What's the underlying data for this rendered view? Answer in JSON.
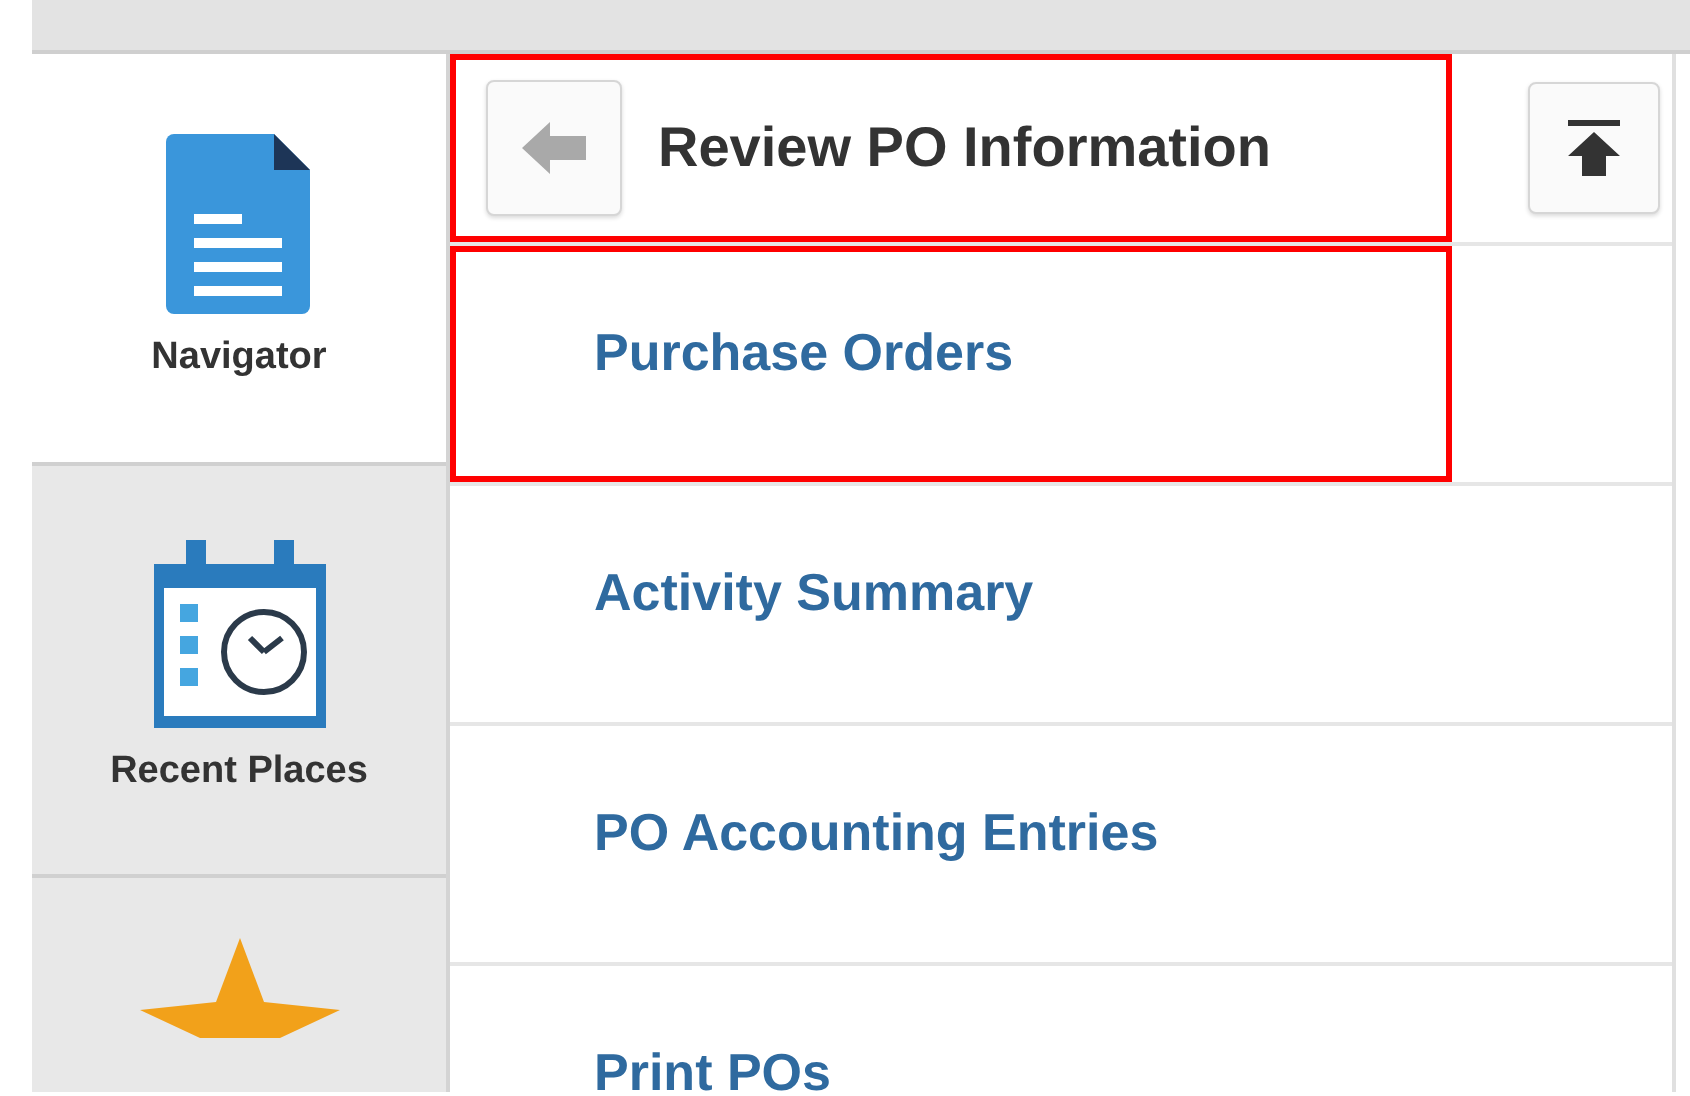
{
  "sidebar": {
    "tiles": [
      {
        "kind": "document",
        "label": "Navigator",
        "selected": true
      },
      {
        "kind": "calendar",
        "label": "Recent Places",
        "selected": false
      },
      {
        "kind": "star",
        "selected": false
      }
    ]
  },
  "header": {
    "title": "Review PO Information",
    "highlighted": true
  },
  "items": [
    {
      "label": "Purchase Orders",
      "highlighted": true
    },
    {
      "label": "Activity Summary",
      "highlighted": false
    },
    {
      "label": "PO Accounting Entries",
      "highlighted": false
    },
    {
      "label": "Print POs",
      "highlighted": false
    }
  ]
}
